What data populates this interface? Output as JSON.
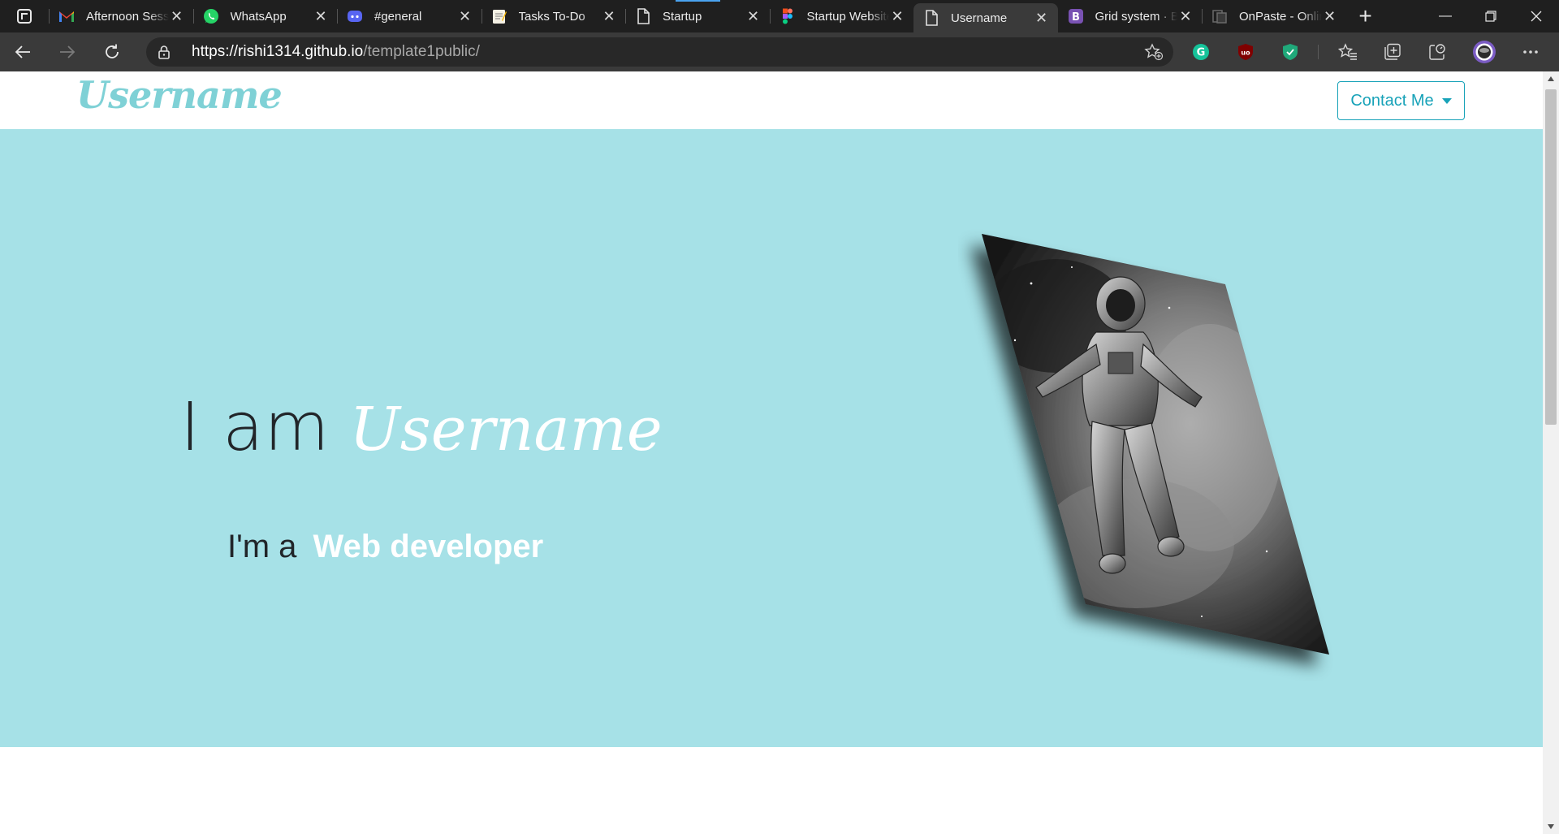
{
  "browser": {
    "tabs": [
      {
        "title": "Afternoon Session",
        "icon": "gmail-icon"
      },
      {
        "title": "WhatsApp",
        "icon": "whatsapp-icon"
      },
      {
        "title": "#general",
        "icon": "discord-icon"
      },
      {
        "title": "Tasks To-Do",
        "icon": "notepad-icon"
      },
      {
        "title": "Startup",
        "icon": "page-icon"
      },
      {
        "title": "Startup Website",
        "icon": "figma-icon"
      },
      {
        "title": "Username",
        "icon": "page-icon"
      },
      {
        "title": "Grid system · Bootstrap",
        "icon": "bootstrap-icon"
      },
      {
        "title": "OnPaste - Online",
        "icon": "onpaste-icon"
      }
    ],
    "active_tab_index": 6,
    "url_host": "https://rishi1314.github.io",
    "url_path": "/template1public/"
  },
  "site": {
    "brand": "Username",
    "contact_button": "Contact Me",
    "hero": {
      "i_am": "I am",
      "name": "Username",
      "role_prefix": "I'm a",
      "role": "Web developer"
    }
  },
  "colors": {
    "hero_bg": "#a6e1e7",
    "brand": "#7fd1d6",
    "accent": "#17a2b8"
  }
}
